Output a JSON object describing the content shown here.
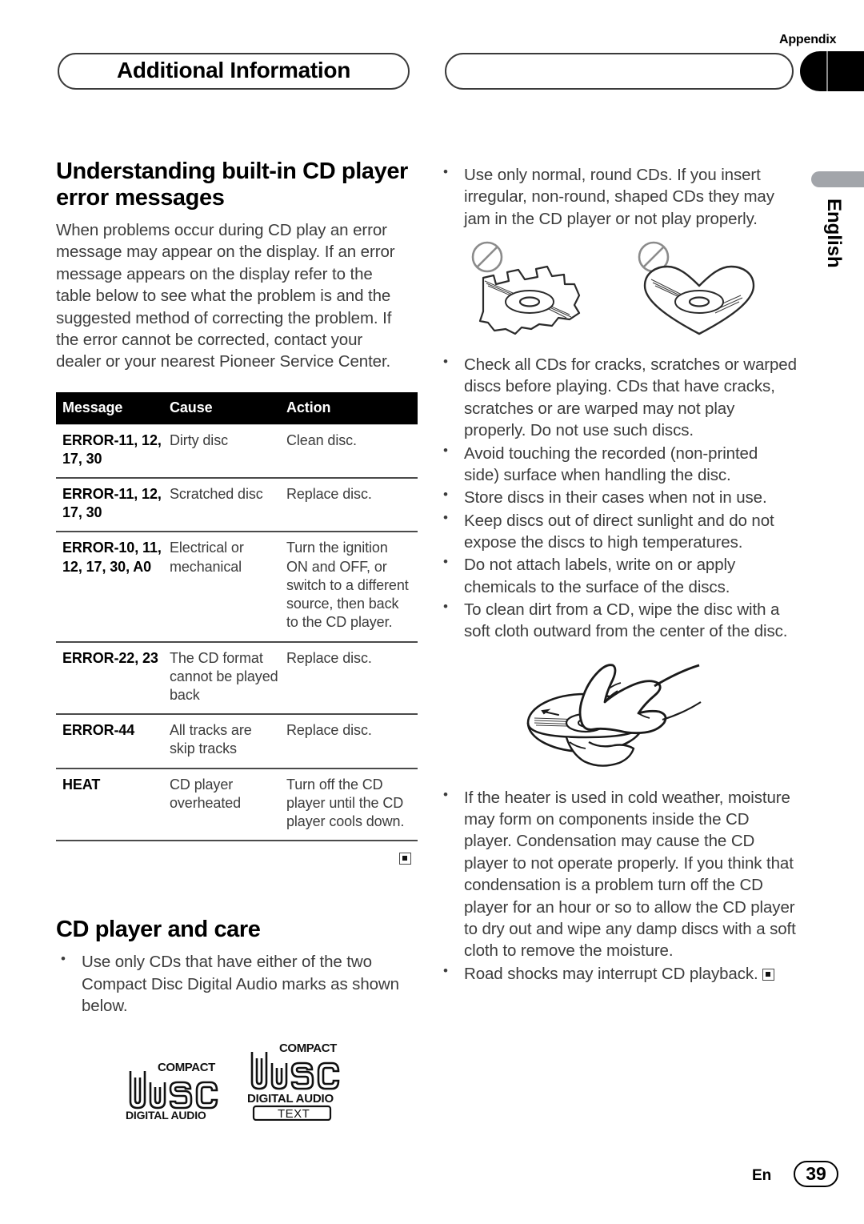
{
  "header": {
    "title": "Additional Information",
    "appendix_label": "Appendix",
    "secondary_pill": ""
  },
  "side_tab": {
    "language": "English"
  },
  "left_column": {
    "section1": {
      "heading": "Understanding built-in CD player error messages",
      "intro": "When problems occur during CD play an error message may appear on the display. If an error message appears on the display refer to the table below to see what the problem is and the suggested method of correcting the problem. If the error cannot be corrected, contact your dealer or your nearest Pioneer Service Center.",
      "table": {
        "columns": [
          "Message",
          "Cause",
          "Action"
        ],
        "rows": [
          {
            "message": "ERROR-11, 12, 17, 30",
            "cause": "Dirty disc",
            "action": "Clean disc."
          },
          {
            "message": "ERROR-11, 12, 17, 30",
            "cause": "Scratched disc",
            "action": "Replace disc."
          },
          {
            "message": "ERROR-10, 11, 12, 17, 30, A0",
            "cause": "Electrical or mechanical",
            "action": "Turn the ignition ON and OFF, or switch to a different source, then back to the CD player."
          },
          {
            "message": "ERROR-22, 23",
            "cause": "The CD format cannot be played back",
            "action": "Replace disc."
          },
          {
            "message": "ERROR-44",
            "cause": "All tracks are skip tracks",
            "action": "Replace disc."
          },
          {
            "message": "HEAT",
            "cause": "CD player overheated",
            "action": "Turn off the CD player until the CD player cools down."
          }
        ]
      }
    },
    "section2": {
      "heading": "CD player and care",
      "bullets": [
        "Use only CDs that have either of the two Compact Disc Digital Audio marks as shown below."
      ],
      "logos": [
        {
          "name": "compact-disc-digital-audio",
          "top_text": "COMPACT",
          "word": "disc",
          "bottom_text": "DIGITAL AUDIO"
        },
        {
          "name": "compact-disc-digital-audio-text",
          "top_text": "COMPACT",
          "word": "disc",
          "bottom_text": "DIGITAL AUDIO",
          "extra_text": "TEXT"
        }
      ]
    }
  },
  "right_column": {
    "bullets_top": [
      "Use only normal, round CDs. If you insert irregular, non-round, shaped CDs they may jam in the CD player or not play properly."
    ],
    "illustration_discs": [
      {
        "name": "prohibited-shaped-disc-gear",
        "label": "no-symbol"
      },
      {
        "name": "prohibited-shaped-disc-heart",
        "label": "no-symbol"
      }
    ],
    "bullets_middle": [
      "Check all CDs for cracks, scratches or warped discs before playing. CDs that have cracks, scratches or are warped may not play properly. Do not use such discs.",
      "Avoid touching the recorded (non-printed side) surface when handling the disc.",
      "Store discs in their cases when not in use.",
      "Keep discs out of direct sunlight and do not expose the discs to high temperatures.",
      "Do not attach labels, write on or apply chemicals to the surface of the discs.",
      "To clean dirt from a CD, wipe the disc with a soft cloth outward from the center of the disc."
    ],
    "illustration_wipe": {
      "name": "hand-wiping-disc-outward"
    },
    "bullets_bottom": [
      "If the heater is used in cold weather, moisture may form on components inside the CD player. Condensation may cause the CD player to not operate properly. If you think that condensation is a problem turn off the CD player for an hour or so to allow the CD player to dry out and wipe any damp discs with a soft cloth to remove the moisture.",
      "Road shocks may interrupt CD playback."
    ]
  },
  "footer": {
    "lang_code": "En",
    "page_number": "39"
  },
  "colors": {
    "text": "#3c3c3c",
    "heading": "#000000",
    "table_header_bg": "#000000",
    "table_header_fg": "#ffffff",
    "rule": "#4a4a4a",
    "side_tab_gray": "#a2a5aa"
  }
}
